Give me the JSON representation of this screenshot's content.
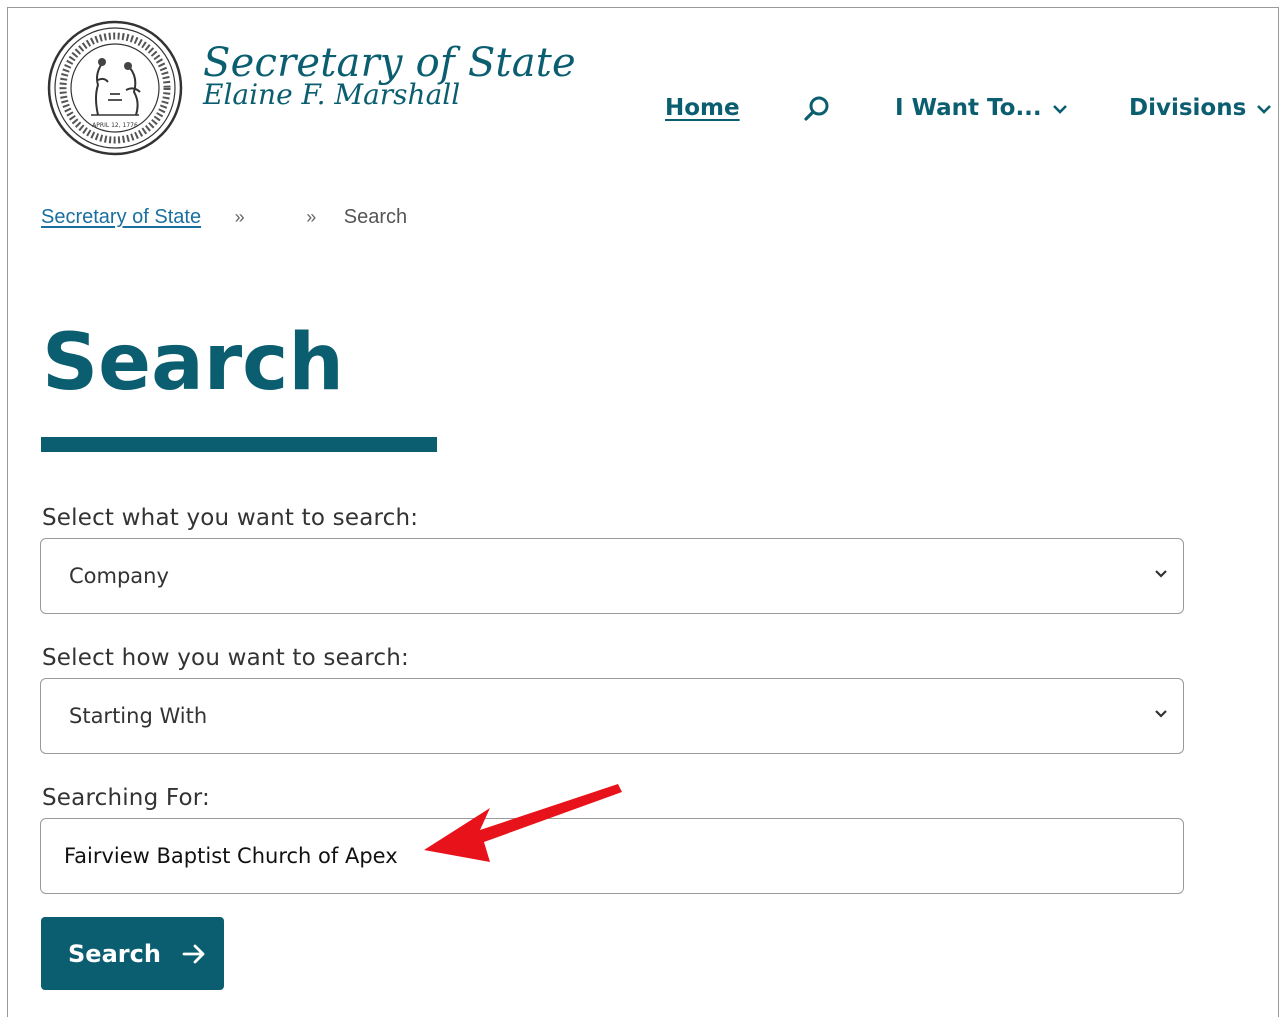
{
  "header": {
    "seal_icon": "nc-secretary-of-state-seal-icon",
    "brand_title": "Secretary of State",
    "brand_subtitle": "Elaine F. Marshall"
  },
  "nav": {
    "home": "Home",
    "search_icon": "search-icon",
    "i_want_to": "I Want To...",
    "divisions": "Divisions"
  },
  "breadcrumb": {
    "root": "Secretary of State",
    "separator": "»",
    "current": "Search"
  },
  "page": {
    "title": "Search"
  },
  "form": {
    "search_type_label": "Select what you want to search:",
    "search_type_value": "Company",
    "search_method_label": "Select how you want to search:",
    "search_method_value": "Starting With",
    "searching_for_label": "Searching For:",
    "searching_for_value": "Fairview Baptist Church of Apex",
    "submit_label": "Search"
  },
  "colors": {
    "brand": "#0b5e6f",
    "annotation_arrow": "#e8121b"
  }
}
